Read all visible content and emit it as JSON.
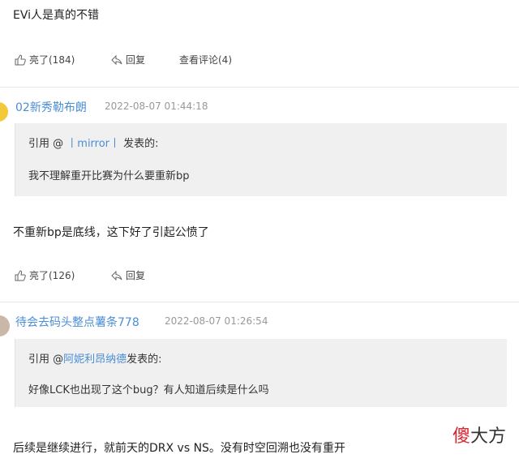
{
  "top_comment": {
    "text": "EVi人是真的不错",
    "like_label": "亮了(184)",
    "reply_label": "回复",
    "view_comments_label": "查看评论(4)"
  },
  "comment1": {
    "username": "02新秀勒布朗",
    "timestamp": "2022-08-07 01:44:18",
    "quote": {
      "prefix": "引用 @",
      "user": "丨mirror丨",
      "suffix": "发表的:",
      "content": "我不理解重开比赛为什么要重新bp"
    },
    "text": "不重新bp是底线，这下好了引起公愤了",
    "like_label": "亮了(126)",
    "reply_label": "回复"
  },
  "comment2": {
    "username": "待会去码头整点薯条778",
    "timestamp": "2022-08-07 01:26:54",
    "quote": {
      "prefix": "引用 @",
      "user": "阿妮利昂纳德",
      "suffix": "发表的:",
      "content": "好像LCK也出现了这个bug？有人知道后续是什么吗"
    },
    "text": "后续是继续进行，就前天的DRX vs NS。没有时空回溯也没有重开"
  },
  "watermark": {
    "first_char": "傻",
    "rest": "大方"
  },
  "colors": {
    "link": "#4a8ed6",
    "quote_bg": "#f0f0f0",
    "watermark_accent": "#d9232d"
  }
}
